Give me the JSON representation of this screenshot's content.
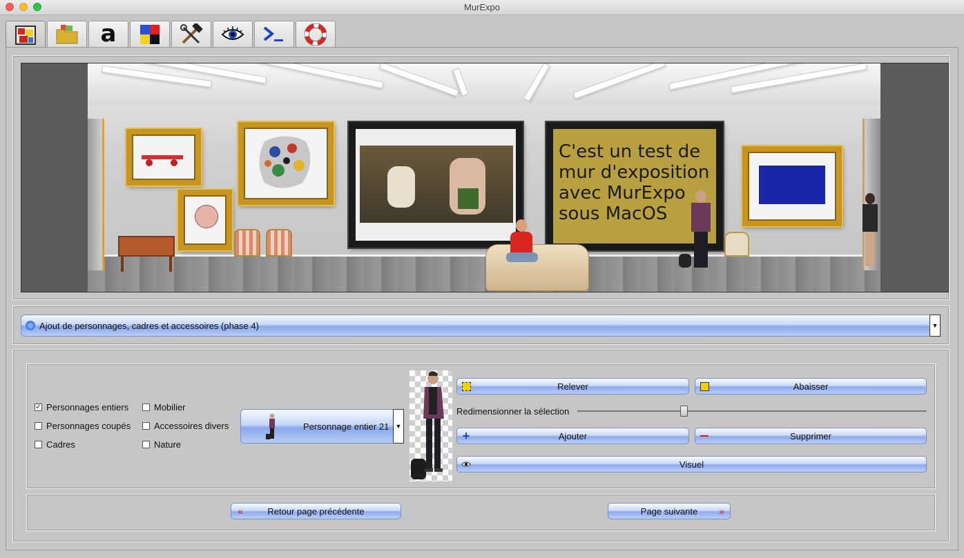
{
  "window": {
    "title": "MurExpo"
  },
  "tabs": [
    {
      "name": "tab-gallery",
      "icon": "gallery-icon"
    },
    {
      "name": "tab-folder",
      "icon": "folder-icon"
    },
    {
      "name": "tab-text",
      "icon": "letter-a-icon"
    },
    {
      "name": "tab-colors",
      "icon": "color-squares-icon"
    },
    {
      "name": "tab-tools",
      "icon": "tools-icon"
    },
    {
      "name": "tab-view",
      "icon": "eye-icon"
    },
    {
      "name": "tab-terminal",
      "icon": "terminal-icon"
    },
    {
      "name": "tab-help",
      "icon": "lifebuoy-icon"
    }
  ],
  "gallery": {
    "poster_text": "C'est un test de\nmur d'exposition\navec MurExpo\nsous MacOS"
  },
  "phase_select": {
    "value": "Ajout de personnages, cadres et accessoires (phase 4)"
  },
  "categories": [
    {
      "label": "Personnages entiers",
      "checked": true
    },
    {
      "label": "Personnages coupés",
      "checked": false
    },
    {
      "label": "Cadres",
      "checked": false
    },
    {
      "label": "Mobilier",
      "checked": false
    },
    {
      "label": "Accessoires divers",
      "checked": false
    },
    {
      "label": "Nature",
      "checked": false
    }
  ],
  "item_select": {
    "value": "Personnage entier 21"
  },
  "actions": {
    "raise": "Relever",
    "lower": "Abaisser",
    "resize_label": "Redimensionner la sélection",
    "add": "Ajouter",
    "delete": "Supprimer",
    "visual": "Visuel"
  },
  "navigation": {
    "prev": "Retour page précédente",
    "next": "Page suivante"
  },
  "colors": {
    "button_top": "#f6f9ff",
    "button_bottom": "#8eabec",
    "poster_bg": "#b8a040",
    "gold_frame": "#c8961f"
  }
}
